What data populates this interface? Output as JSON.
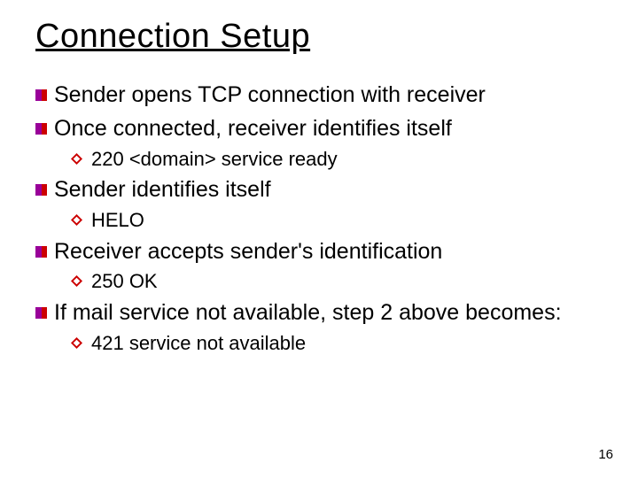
{
  "title": "Connection Setup",
  "items": [
    {
      "level": 1,
      "text": "Sender opens TCP connection with receiver"
    },
    {
      "level": 1,
      "text": "Once connected, receiver identifies itself"
    },
    {
      "level": 2,
      "text": "220 <domain> service ready"
    },
    {
      "level": 1,
      "text": "Sender identifies itself"
    },
    {
      "level": 2,
      "text": "HELO"
    },
    {
      "level": 1,
      "text": "Receiver accepts sender's identification"
    },
    {
      "level": 2,
      "text": "250 OK"
    },
    {
      "level": 1,
      "text": "If mail service not available, step 2 above becomes:"
    },
    {
      "level": 2,
      "text": "421 service not available"
    }
  ],
  "page_number": "16"
}
